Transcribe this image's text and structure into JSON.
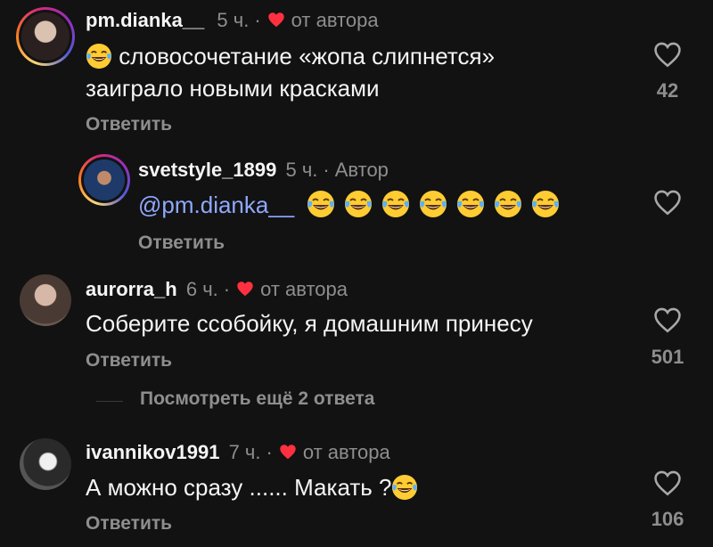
{
  "colors": {
    "background": "#121212",
    "text": "#f5f5f5",
    "muted": "#8e8e8e",
    "heart": "#ff3040",
    "mention": "#8fa8ff"
  },
  "comments": [
    {
      "username": "pm.dianka__",
      "time": "5 ч.",
      "author_like": "от автора",
      "text_line1": "словосочетание «жопа слипнется»",
      "text_line2": "заиграло новыми красками",
      "reply": "Ответить",
      "likes": "42"
    },
    {
      "username": "svetstyle_1899",
      "time": "5 ч.",
      "author_tag": "Автор",
      "mention": "@pm.dianka__",
      "reply": "Ответить"
    },
    {
      "username": "aurorra_h",
      "time": "6 ч.",
      "author_like": "от автора",
      "text": "Соберите ссобойку, я домашним принесу",
      "reply": "Ответить",
      "likes": "501"
    },
    {
      "username": "ivannikov1991",
      "time": "7 ч.",
      "author_like": "от автора",
      "text": "А можно сразу ...... Макать ?",
      "reply": "Ответить",
      "likes": "106"
    }
  ],
  "more_replies": "Посмотреть ещё 2 ответа",
  "icons": {
    "like": "heart-outline-icon",
    "author_like": "heart-filled-icon",
    "emoji": "tears-of-joy-emoji"
  }
}
